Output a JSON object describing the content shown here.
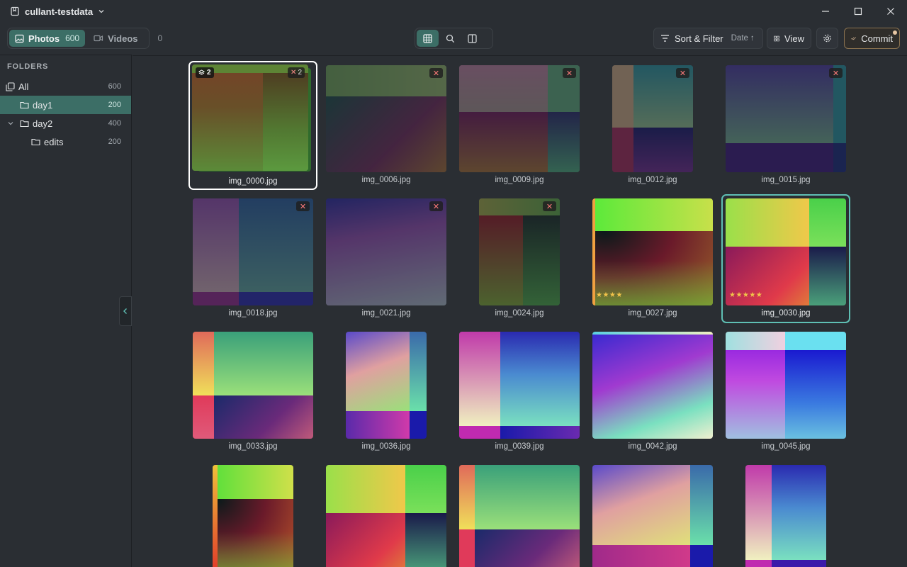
{
  "window": {
    "title": "cullant-testdata"
  },
  "toolbar": {
    "photos_label": "Photos",
    "photos_count": "600",
    "videos_label": "Videos",
    "videos_count": "0",
    "sort_label": "Sort & Filter",
    "sort_field": "Date",
    "sort_dir": "↑",
    "view_label": "View",
    "commit_label": "Commit"
  },
  "sidebar": {
    "heading": "FOLDERS",
    "items": [
      {
        "label": "All",
        "count": "600"
      },
      {
        "label": "day1",
        "count": "200"
      },
      {
        "label": "day2",
        "count": "400"
      },
      {
        "label": "edits",
        "count": "200"
      }
    ]
  },
  "grid": {
    "items": [
      {
        "name": "img_0000.jpg",
        "stack": "2",
        "rejected_in_stack": "2"
      },
      {
        "name": "img_0006.jpg",
        "rejected": true
      },
      {
        "name": "img_0009.jpg",
        "rejected": true
      },
      {
        "name": "img_0012.jpg",
        "rejected": true
      },
      {
        "name": "img_0015.jpg",
        "rejected": true
      },
      {
        "name": "img_0018.jpg",
        "rejected": true
      },
      {
        "name": "img_0021.jpg",
        "rejected": true
      },
      {
        "name": "img_0024.jpg",
        "rejected": true
      },
      {
        "name": "img_0027.jpg",
        "rating": 4
      },
      {
        "name": "img_0030.jpg",
        "rating": 5
      },
      {
        "name": "img_0033.jpg"
      },
      {
        "name": "img_0036.jpg"
      },
      {
        "name": "img_0039.jpg"
      },
      {
        "name": "img_0042.jpg"
      },
      {
        "name": "img_0045.jpg"
      }
    ]
  },
  "colors": {
    "accent": "#3c6e66",
    "focus_ring": "#5fbfb4",
    "reject": "#ff7a7a",
    "star": "#f0c24a"
  }
}
